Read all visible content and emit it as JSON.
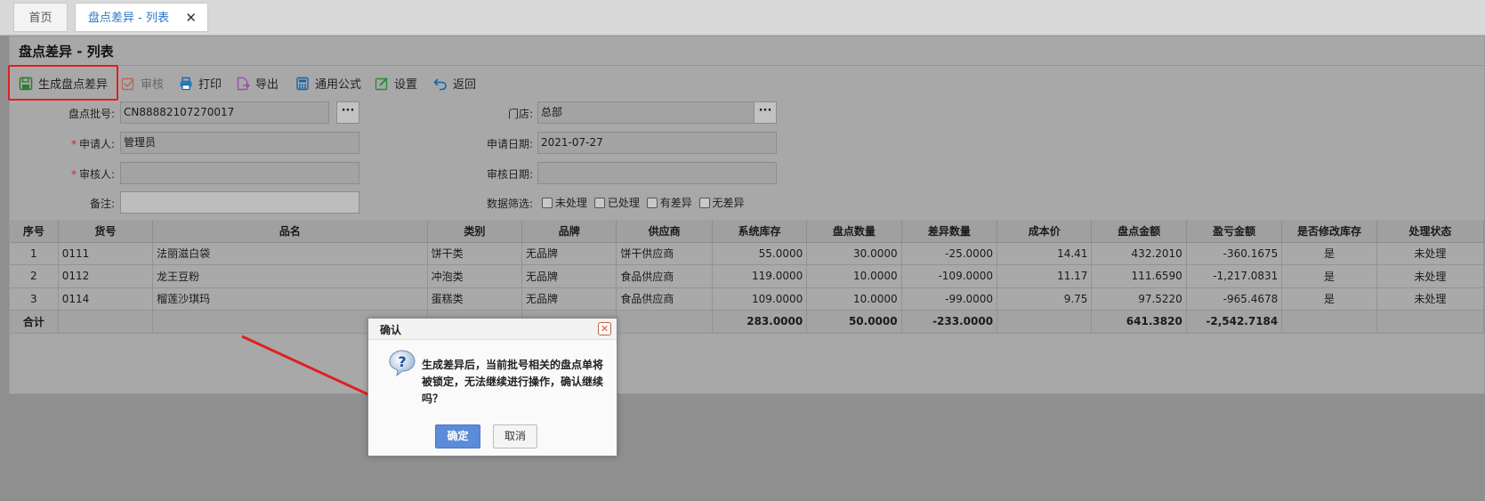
{
  "tabs": {
    "home": "首页",
    "active": "盘点差异 - 列表",
    "close": "✕"
  },
  "page_title": "盘点差异 - 列表",
  "toolbar": {
    "generate": "生成盘点差异",
    "audit": "审核",
    "print": "打印",
    "export": "导出",
    "formula": "通用公式",
    "settings": "设置",
    "back": "返回"
  },
  "form": {
    "batch_label": "盘点批号:",
    "batch_value": "CN88882107270017",
    "store_label": "门店:",
    "store_value": "总部",
    "applicant_label": "申请人:",
    "applicant_value": "管理员",
    "apply_date_label": "申请日期:",
    "apply_date_value": "2021-07-27",
    "auditor_label": "审核人:",
    "auditor_value": "",
    "audit_date_label": "审核日期:",
    "audit_date_value": "",
    "remark_label": "备注:",
    "remark_value": "",
    "filter_label": "数据筛选:",
    "filters": [
      "未处理",
      "已处理",
      "有差异",
      "无差异"
    ],
    "required_mark": "*",
    "dots": "···"
  },
  "table": {
    "headers": [
      "序号",
      "货号",
      "品名",
      "类别",
      "品牌",
      "供应商",
      "系统库存",
      "盘点数量",
      "差异数量",
      "成本价",
      "盘点金额",
      "盈亏金额",
      "是否修改库存",
      "处理状态"
    ],
    "rows": [
      [
        "1",
        "0111",
        "法丽滋白袋",
        "饼干类",
        "无品牌",
        "饼干供应商",
        "55.0000",
        "30.0000",
        "-25.0000",
        "14.41",
        "432.2010",
        "-360.1675",
        "是",
        "未处理"
      ],
      [
        "2",
        "0112",
        "龙王豆粉",
        "冲泡类",
        "无品牌",
        "食品供应商",
        "119.0000",
        "10.0000",
        "-109.0000",
        "11.17",
        "111.6590",
        "-1,217.0831",
        "是",
        "未处理"
      ],
      [
        "3",
        "0114",
        "榴莲沙琪玛",
        "蛋糕类",
        "无品牌",
        "食品供应商",
        "109.0000",
        "10.0000",
        "-99.0000",
        "9.75",
        "97.5220",
        "-965.4678",
        "是",
        "未处理"
      ]
    ],
    "total": {
      "label": "合计",
      "system_stock": "283.0000",
      "count_qty": "50.0000",
      "diff_qty": "-233.0000",
      "count_amount": "641.3820",
      "profit_loss": "-2,542.7184"
    }
  },
  "dialog": {
    "title": "确认",
    "close": "✕",
    "message": "生成差异后，当前批号相关的盘点单将被锁定，无法继续进行操作，确认继续吗？",
    "ok": "确定",
    "cancel": "取消"
  },
  "colors": {
    "accent": "#2d78c8",
    "highlight": "#e02020",
    "ok_button": "#5b8bd9"
  }
}
